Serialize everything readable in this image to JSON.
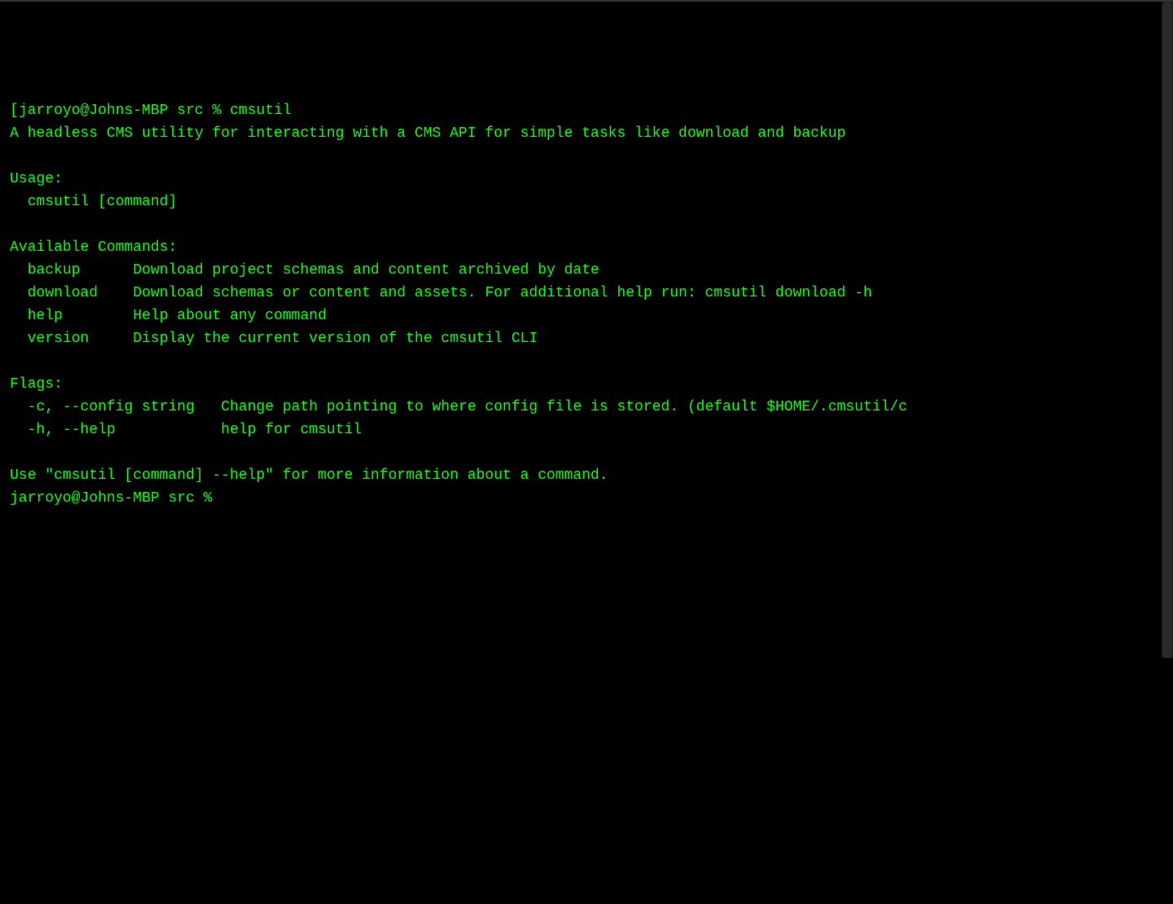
{
  "prompt1": {
    "bracket": "[",
    "user_host": "jarroyo@Johns-MBP",
    "path": "src",
    "symbol": "%",
    "command": "cmsutil"
  },
  "description": "A headless CMS utility for interacting with a CMS API for simple tasks like download and backup",
  "usage_header": "Usage:",
  "usage_line": "  cmsutil [command]",
  "commands_header": "Available Commands:",
  "commands": [
    {
      "name": "backup",
      "pad": "      ",
      "desc": "Download project schemas and content archived by date"
    },
    {
      "name": "download",
      "pad": "    ",
      "desc": "Download schemas or content and assets. For additional help run: cmsutil download -h"
    },
    {
      "name": "help",
      "pad": "        ",
      "desc": "Help about any command"
    },
    {
      "name": "version",
      "pad": "     ",
      "desc": "Display the current version of the cmsutil CLI"
    }
  ],
  "flags_header": "Flags:",
  "flags": [
    {
      "flag": "-c, --config string",
      "pad": "   ",
      "desc": "Change path pointing to where config file is stored. (default $HOME/.cmsutil/c"
    },
    {
      "flag": "-h, --help",
      "pad": "            ",
      "desc": "help for cmsutil"
    }
  ],
  "footer": "Use \"cmsutil [command] --help\" for more information about a command.",
  "prompt2": {
    "user_host": "jarroyo@Johns-MBP",
    "path": "src",
    "symbol": "%"
  }
}
